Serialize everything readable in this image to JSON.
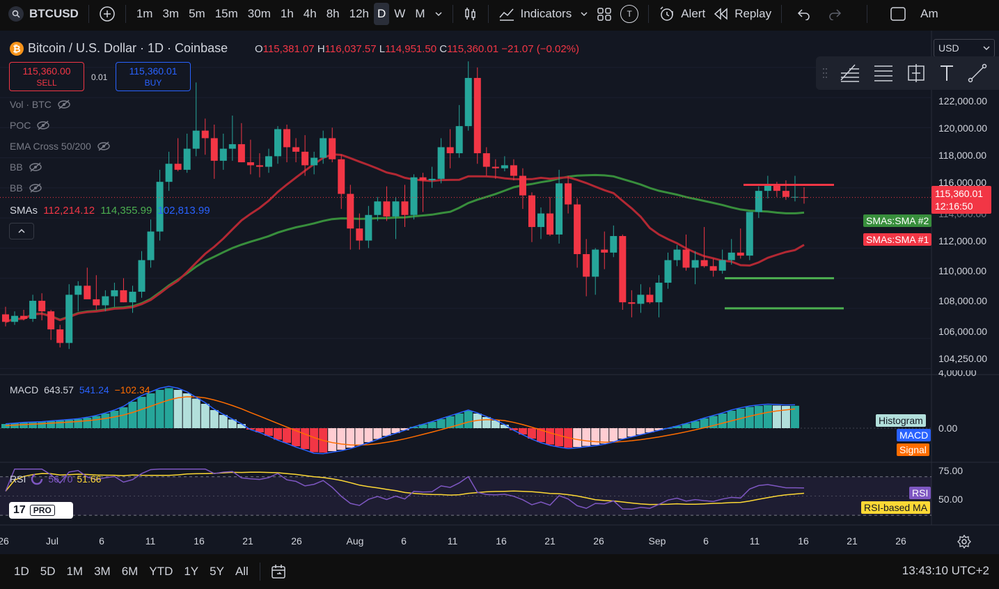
{
  "toolbar": {
    "symbol": "BTCUSD",
    "intervals": [
      "1m",
      "3m",
      "5m",
      "15m",
      "30m",
      "1h",
      "4h",
      "8h",
      "12h",
      "D",
      "W",
      "M"
    ],
    "active_interval": "D",
    "indicators_label": "Indicators",
    "alert_label": "Alert",
    "replay_label": "Replay",
    "t_label": "T",
    "truncated_label": "Am"
  },
  "legend": {
    "title": "Bitcoin / U.S. Dollar · 1D · Coinbase",
    "o_key": "O",
    "o_val": "115,381.07",
    "h_key": "H",
    "h_val": "116,037.57",
    "l_key": "L",
    "l_val": "114,951.50",
    "c_key": "C",
    "c_val": "115,360.01",
    "change": "−21.07 (−0.02%)"
  },
  "trade": {
    "sell_price": "115,360.00",
    "sell_label": "SELL",
    "buy_price": "115,360.01",
    "buy_label": "BUY",
    "spread": "0.01"
  },
  "indicators": {
    "vol": "Vol · BTC",
    "poc": "POC",
    "ema": "EMA Cross 50/200",
    "bb1": "BB",
    "bb2": "BB",
    "smas_label": "SMAs",
    "sma1_val": "112,214.12",
    "sma2_val": "114,355.99",
    "sma3_val": "102,813.99"
  },
  "currency": "USD",
  "price_axis": {
    "labels": [
      "122,000.00",
      "120,000.00",
      "118,000.00",
      "116,000.00",
      "112,000.00",
      "110,000.00",
      "108,000.00",
      "106,000.00",
      "104,250.00",
      "4,000.00"
    ],
    "partial_label": "114,000.00",
    "last_price": "115,360.01",
    "countdown": "12:16:50",
    "sma2_badge": "SMAs:SMA #2",
    "sma1_badge": "SMAs:SMA #1"
  },
  "macd": {
    "label": "MACD",
    "v1": "643.57",
    "v2": "541.24",
    "v3": "−102.34",
    "axis_zero": "0.00",
    "badge_hist": "Histogram",
    "badge_macd": "MACD",
    "badge_signal": "Signal"
  },
  "rsi": {
    "label": "RSI",
    "v1": "56.70",
    "v2": "51.66",
    "axis_75": "75.00",
    "axis_50": "50.00",
    "badge_rsi": "RSI",
    "badge_ma": "RSI-based MA"
  },
  "logo": {
    "pro": "PRO",
    "mark": "17"
  },
  "date_axis": [
    "26",
    "Jul",
    "6",
    "11",
    "16",
    "21",
    "26",
    "Aug",
    "6",
    "11",
    "16",
    "21",
    "26",
    "Sep",
    "6",
    "11",
    "16",
    "21",
    "26"
  ],
  "bottom": {
    "ranges": [
      "1D",
      "5D",
      "1M",
      "3M",
      "6M",
      "YTD",
      "1Y",
      "5Y",
      "All"
    ],
    "clock": "13:43:10 UTC+2"
  },
  "colors": {
    "up": "#26a69a",
    "down": "#f23645",
    "sma1": "#b22833",
    "sma2": "#388e3c",
    "macd": "#2962ff",
    "signal": "#ff6d00",
    "rsi": "#7e57c2",
    "rsi_ma": "#fdd835"
  },
  "icons": [
    "plus-icon",
    "candles-icon",
    "indicators-icon",
    "layouts-icon",
    "alert-icon",
    "replay-icon",
    "undo-icon",
    "redo-icon",
    "fullscreen-icon",
    "eye-off-icon",
    "chevron-up-icon",
    "settings-icon",
    "calendar-icon"
  ],
  "chart_data": {
    "type": "candlestick",
    "candles": [
      [
        107600,
        108100,
        106800,
        107100
      ],
      [
        107100,
        107800,
        106900,
        107500
      ],
      [
        107500,
        107900,
        107200,
        107300
      ],
      [
        107300,
        108900,
        107100,
        108500
      ],
      [
        108500,
        109000,
        107200,
        107800
      ],
      [
        107800,
        107900,
        105900,
        106600
      ],
      [
        106600,
        106900,
        105400,
        105700
      ],
      [
        105700,
        109600,
        105300,
        108900
      ],
      [
        108900,
        109800,
        107800,
        109500
      ],
      [
        109500,
        110700,
        108900,
        108600
      ],
      [
        108600,
        110200,
        107900,
        108200
      ],
      [
        108200,
        109200,
        107800,
        108800
      ],
      [
        108800,
        109700,
        108100,
        109200
      ],
      [
        109200,
        110000,
        108400,
        108400
      ],
      [
        108400,
        109500,
        107700,
        109100
      ],
      [
        109100,
        111800,
        108700,
        111200
      ],
      [
        111200,
        113900,
        110700,
        113100
      ],
      [
        113100,
        117200,
        112500,
        116400
      ],
      [
        116400,
        118400,
        115800,
        117600
      ],
      [
        117600,
        119300,
        117100,
        117200
      ],
      [
        117200,
        119600,
        117000,
        118600
      ],
      [
        118600,
        123000,
        118100,
        119800
      ],
      [
        119800,
        120600,
        118200,
        119300
      ],
      [
        119300,
        120200,
        116600,
        117800
      ],
      [
        117800,
        119600,
        117200,
        118600
      ],
      [
        118600,
        120800,
        117800,
        118900
      ],
      [
        118900,
        120300,
        117700,
        117700
      ],
      [
        117700,
        119200,
        116900,
        117500
      ],
      [
        117500,
        118300,
        116700,
        117400
      ],
      [
        117400,
        118600,
        117000,
        118100
      ],
      [
        118100,
        120100,
        117600,
        119900
      ],
      [
        119900,
        120200,
        117700,
        118700
      ],
      [
        118700,
        119300,
        117700,
        118400
      ],
      [
        118400,
        119500,
        116800,
        117500
      ],
      [
        117500,
        118400,
        116900,
        118000
      ],
      [
        118000,
        119800,
        117600,
        119300
      ],
      [
        119300,
        120000,
        117700,
        117900
      ],
      [
        117900,
        118200,
        114600,
        115600
      ],
      [
        115600,
        116200,
        111900,
        113300
      ],
      [
        113300,
        114300,
        111900,
        112500
      ],
      [
        112500,
        114800,
        112000,
        114200
      ],
      [
        114200,
        115400,
        113800,
        115100
      ],
      [
        115100,
        116100,
        113800,
        114100
      ],
      [
        114100,
        115400,
        112600,
        115100
      ],
      [
        115100,
        116200,
        113400,
        114200
      ],
      [
        114200,
        116900,
        113900,
        116700
      ],
      [
        116700,
        117000,
        114400,
        116500
      ],
      [
        116500,
        117400,
        116000,
        116600
      ],
      [
        116600,
        119300,
        116300,
        118700
      ],
      [
        118700,
        119900,
        117300,
        118300
      ],
      [
        118300,
        121500,
        118000,
        120100
      ],
      [
        120100,
        124400,
        119800,
        123300
      ],
      [
        123300,
        124000,
        117600,
        118300
      ],
      [
        118300,
        118700,
        116800,
        117400
      ],
      [
        117400,
        117900,
        116600,
        117300
      ],
      [
        117300,
        118100,
        117100,
        117500
      ],
      [
        117500,
        117900,
        116500,
        116800
      ],
      [
        116800,
        117300,
        114600,
        115500
      ],
      [
        115500,
        115700,
        112400,
        113400
      ],
      [
        113400,
        114700,
        112600,
        114300
      ],
      [
        114300,
        115400,
        112800,
        112900
      ],
      [
        112900,
        117200,
        112300,
        116300
      ],
      [
        116300,
        116800,
        114300,
        114900
      ],
      [
        114900,
        115300,
        110700,
        111600
      ],
      [
        111600,
        112600,
        108800,
        110100
      ],
      [
        110100,
        112000,
        108900,
        111900
      ],
      [
        111900,
        113100,
        110600,
        111700
      ],
      [
        111700,
        113500,
        111400,
        112800
      ],
      [
        112800,
        112900,
        107900,
        108400
      ],
      [
        108400,
        109200,
        107400,
        108300
      ],
      [
        108300,
        109600,
        107700,
        108900
      ],
      [
        108900,
        109400,
        108300,
        108400
      ],
      [
        108400,
        110200,
        107400,
        109700
      ],
      [
        109700,
        111700,
        109300,
        111200
      ],
      [
        111200,
        112200,
        110800,
        111900
      ],
      [
        111900,
        112900,
        110500,
        110700
      ],
      [
        110700,
        111800,
        109600,
        111200
      ],
      [
        111200,
        113400,
        110700,
        110800
      ],
      [
        110800,
        111300,
        110100,
        110500
      ],
      [
        110500,
        111900,
        110300,
        111200
      ],
      [
        111200,
        112600,
        110900,
        111700
      ],
      [
        111700,
        113300,
        111300,
        111500
      ],
      [
        111500,
        113900,
        111200,
        114400
      ],
      [
        114400,
        116100,
        114000,
        115800
      ],
      [
        115800,
        116800,
        115300,
        116200
      ],
      [
        116200,
        116400,
        115400,
        115800
      ],
      [
        115800,
        116500,
        115200,
        115400
      ],
      [
        115400,
        116800,
        115100,
        115400
      ],
      [
        115381.07,
        116037.57,
        114951.5,
        115360.01
      ]
    ],
    "sma1_last": 112214.12,
    "sma2_last": 114355.99,
    "y_range": [
      103600,
      124500
    ],
    "horizontal_lines": [
      116200,
      110000,
      108000
    ],
    "macd_hist": [
      120,
      140,
      160,
      170,
      180,
      200,
      220,
      240,
      260,
      300,
      350,
      420,
      500,
      600,
      760,
      900,
      1000,
      1100,
      1150,
      1100,
      1000,
      850,
      700,
      520,
      380,
      250,
      120,
      -40,
      -120,
      -220,
      -330,
      -420,
      -520,
      -600,
      -690,
      -700,
      -660,
      -620,
      -560,
      -480,
      -400,
      -310,
      -220,
      -140,
      -60,
      40,
      110,
      180,
      260,
      340,
      420,
      500,
      420,
      320,
      220,
      100,
      -60,
      -180,
      -300,
      -400,
      -470,
      -520,
      -560,
      -540,
      -510,
      -480,
      -440,
      -380,
      -300,
      -240,
      -180,
      -120,
      -60,
      0,
      60,
      130,
      200,
      280,
      350,
      420,
      500,
      560,
      610,
      640,
      660,
      650,
      640,
      643
    ]
  }
}
